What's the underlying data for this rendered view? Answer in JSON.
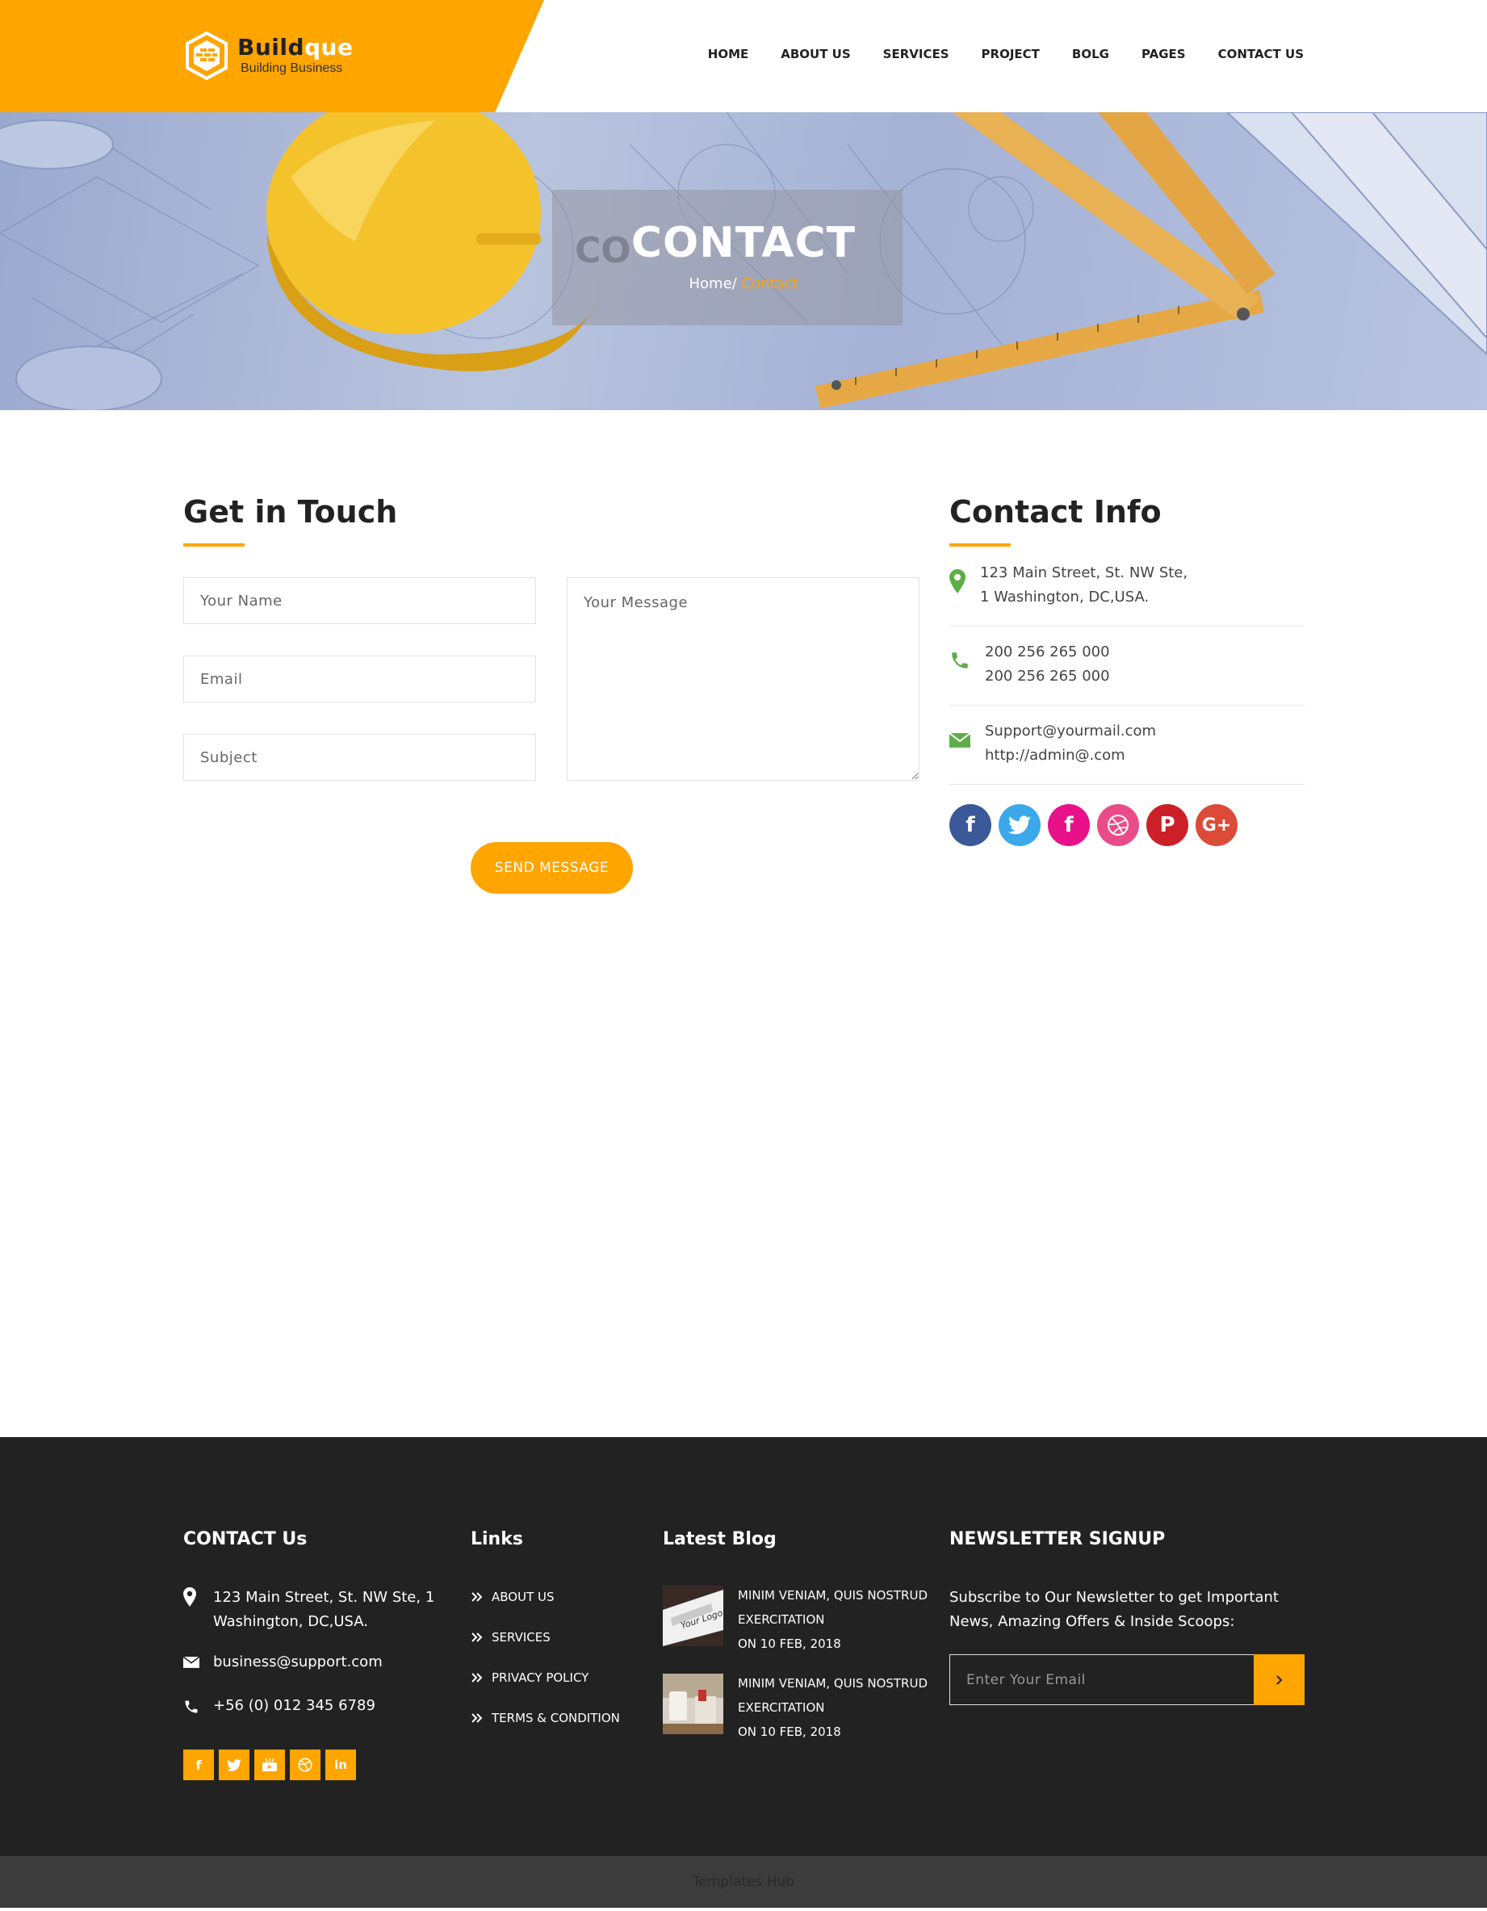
{
  "brand": {
    "name_dark": "Build",
    "name_light": "que",
    "tagline": "Building Business"
  },
  "nav": [
    "HOME",
    "ABOUT US",
    "SERVICES",
    "PROJECT",
    "BOLG",
    "PAGES",
    "CONTACT US"
  ],
  "banner": {
    "ghost": "CO",
    "title": "CONTACT",
    "crumb_home": "Home/",
    "crumb_current": " Contact"
  },
  "form": {
    "title": "Get in Touch",
    "name_placeholder": "Your Name",
    "email_placeholder": "Email",
    "subject_placeholder": "Subject",
    "message_placeholder": "Your Message",
    "send_label": "SEND MESSAGE"
  },
  "contact_info": {
    "title": "Contact Info",
    "address": [
      "123 Main Street, St. NW Ste,",
      "1 Washington, DC,USA."
    ],
    "phones": [
      "200 256 265 000",
      "200 256 265 000"
    ],
    "emails": [
      "Support@yourmail.com",
      "http://admin@.com"
    ],
    "socials": [
      {
        "icon": "facebook-icon",
        "glyph": "f",
        "color": "#3b5998"
      },
      {
        "icon": "twitter-icon",
        "glyph": "t",
        "color": "#3ba9e9"
      },
      {
        "icon": "facebook-icon",
        "glyph": "f",
        "color": "#e8118a"
      },
      {
        "icon": "dribbble-icon",
        "glyph": "d",
        "color": "#ea4c89"
      },
      {
        "icon": "pinterest-icon",
        "glyph": "P",
        "color": "#cb2027"
      },
      {
        "icon": "google-plus-icon",
        "glyph": "G+",
        "color": "#dc4a38"
      }
    ]
  },
  "footer": {
    "contact": {
      "title": "CONTACT Us",
      "address": [
        "123 Main Street, St. NW Ste, 1",
        "Washington, DC,USA."
      ],
      "email": "business@support.com",
      "phone": "+56 (0) 012 345 6789",
      "socials": [
        "facebook-icon",
        "twitter-icon",
        "youtube-icon",
        "dribbble-icon",
        "linkedin-icon"
      ]
    },
    "links": {
      "title": "Links",
      "items": [
        "ABOUT US",
        "SERVICES",
        "PRIVACY POLICY",
        "TERMS & CONDITION"
      ]
    },
    "blog": {
      "title": "Latest Blog",
      "posts": [
        {
          "line1": "MINIM VENIAM, QUIS NOSTRUD",
          "line2": "EXERCITATION",
          "date": "ON 10 FEB, 2018"
        },
        {
          "line1": "MINIM VENIAM, QUIS NOSTRUD",
          "line2": "EXERCITATION",
          "date": "ON 10 FEB, 2018"
        }
      ]
    },
    "newsletter": {
      "title": "NEWSLETTER SIGNUP",
      "text": [
        "Subscribe to Our Newsletter to get Important",
        "News, Amazing Offers & Inside Scoops:"
      ],
      "placeholder": "Enter Your Email"
    }
  },
  "copyright": "Templates Hub",
  "colors": {
    "accent": "#fea500",
    "footer_bg": "#222222",
    "info_icon": "#5eae47"
  }
}
